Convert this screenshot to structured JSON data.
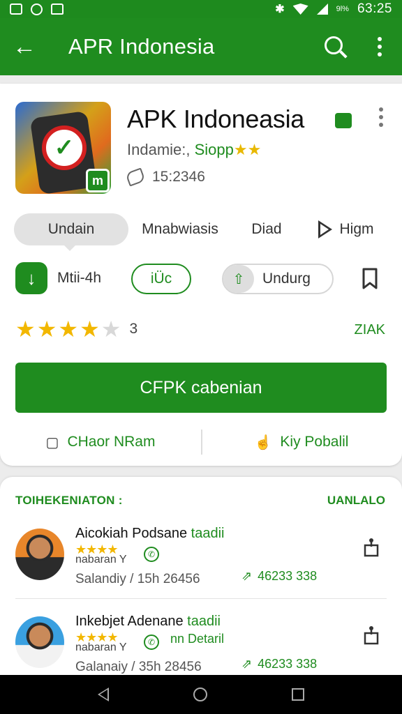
{
  "status_bar": {
    "battery_text": "9l%",
    "time": "63:25"
  },
  "app_bar": {
    "title": "APR Indonesia",
    "back_icon": "arrow-left",
    "search_icon": "search",
    "menu_icon": "more-vert"
  },
  "app": {
    "name": "APK Indoneasia",
    "developer": "Indamie:,",
    "developer_sub": "Siopp",
    "developer_stars": "★★",
    "downloads": "15:2346"
  },
  "tabs": [
    "Undain",
    "Mnabwiasis",
    "Diad",
    "Higm"
  ],
  "actions": {
    "install_label": "Mtii-4h",
    "mid_label": "iÜc",
    "share_label": "Undurg"
  },
  "rating": {
    "stars_filled": 4,
    "stars_total": 5,
    "count": "3",
    "right_label": "ZIAK"
  },
  "cta_label": "CFPK cabenian",
  "links": {
    "left": "CHaor NRam",
    "right": "Kiy Pobalil"
  },
  "reviews_section": {
    "header": "TOIHEKENIATON :",
    "link": "UANLALO",
    "items": [
      {
        "name": "Aicokiah Podsane",
        "name_green": "taadii",
        "stars": "★★★★",
        "sub": "nabaran Y",
        "chat_text": "",
        "date": "Salandiy / 15h 26456",
        "count": "46233 338"
      },
      {
        "name": "Inkebjet Adenane",
        "name_green": "taadii",
        "stars": "★★★★",
        "sub": "nabaran Y",
        "chat_text": "nn Detaril",
        "date": "Galanaiy / 35h 28456",
        "count": "46233 338"
      }
    ]
  },
  "colors": {
    "primary_green": "#1f8c1f",
    "star": "#f2b700",
    "nav_bar": "#000000"
  }
}
